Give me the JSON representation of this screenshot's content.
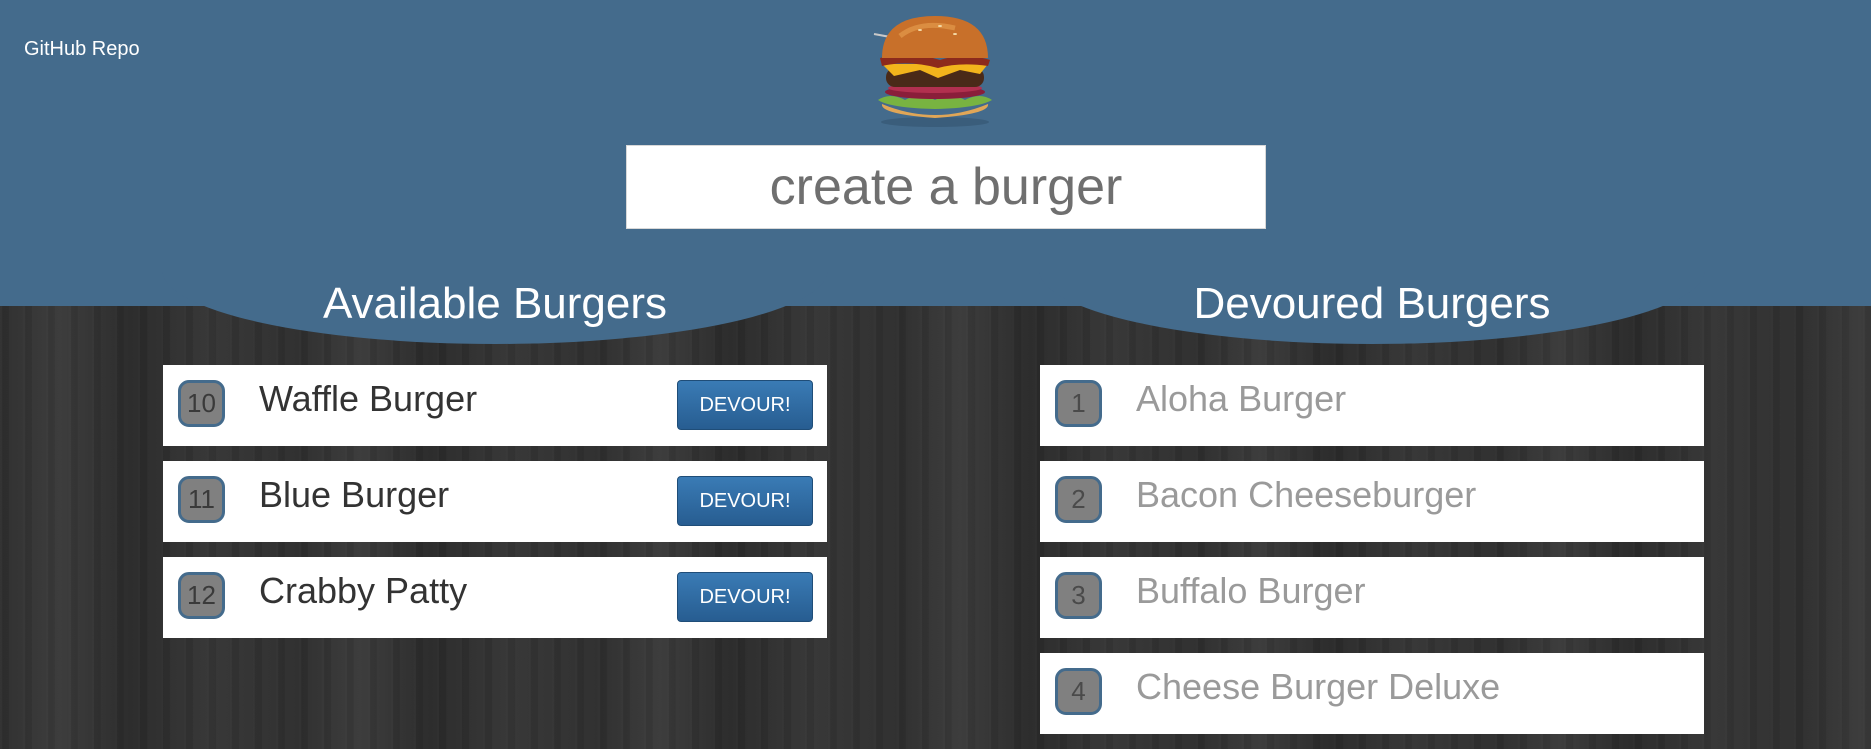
{
  "header": {
    "repo_link": "GitHub Repo",
    "create_placeholder": "create a burger"
  },
  "available": {
    "title": "Available Burgers",
    "button_label": "DEVOUR!",
    "items": [
      {
        "id": "10",
        "name": "Waffle Burger"
      },
      {
        "id": "11",
        "name": "Blue Burger"
      },
      {
        "id": "12",
        "name": "Crabby Patty"
      }
    ]
  },
  "devoured": {
    "title": "Devoured Burgers",
    "items": [
      {
        "id": "1",
        "name": "Aloha Burger"
      },
      {
        "id": "2",
        "name": "Bacon Cheeseburger"
      },
      {
        "id": "3",
        "name": "Buffalo Burger"
      },
      {
        "id": "4",
        "name": "Cheese Burger Deluxe"
      }
    ]
  },
  "colors": {
    "header_blue": "#446b8c",
    "button_blue": "#2f6aa3",
    "badge_gray": "#808080"
  },
  "icons": {
    "logo": "burger-logo-image"
  }
}
